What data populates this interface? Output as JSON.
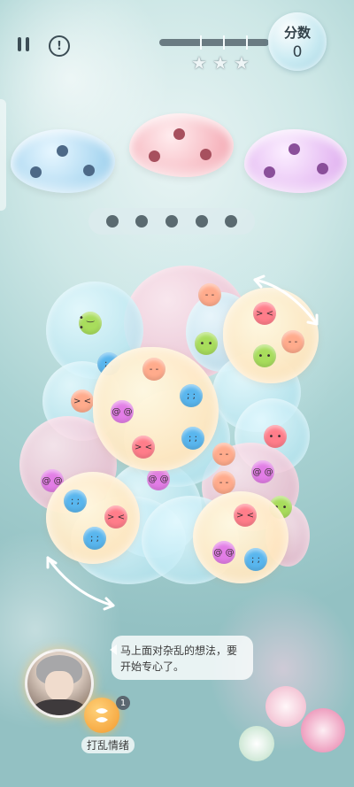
{
  "hud": {
    "score_label": "分数",
    "score_value": "0",
    "progress_fraction": 0.0,
    "stars_earned": 0,
    "stars_total": 3
  },
  "targets": [
    {
      "color": "blue",
      "dots": 3
    },
    {
      "color": "red",
      "dots": 3
    },
    {
      "color": "purple",
      "dots": 3
    }
  ],
  "slots": {
    "count": 5,
    "filled": 0
  },
  "board": {
    "jelly_colors": {
      "green": "#a8dd5c",
      "red": "#ff7d8a",
      "blue": "#59b6ee",
      "purple": "#e27de6",
      "orange": "#ffab8c"
    }
  },
  "dialogue": {
    "text": "马上面对杂乱的想法，要开始专心了。"
  },
  "skill": {
    "label": "打乱情绪",
    "count": "1"
  },
  "icons": [
    "pause-icon",
    "info-icon",
    "star-icon",
    "rotate-arrow-icon",
    "shuffle-icon"
  ]
}
